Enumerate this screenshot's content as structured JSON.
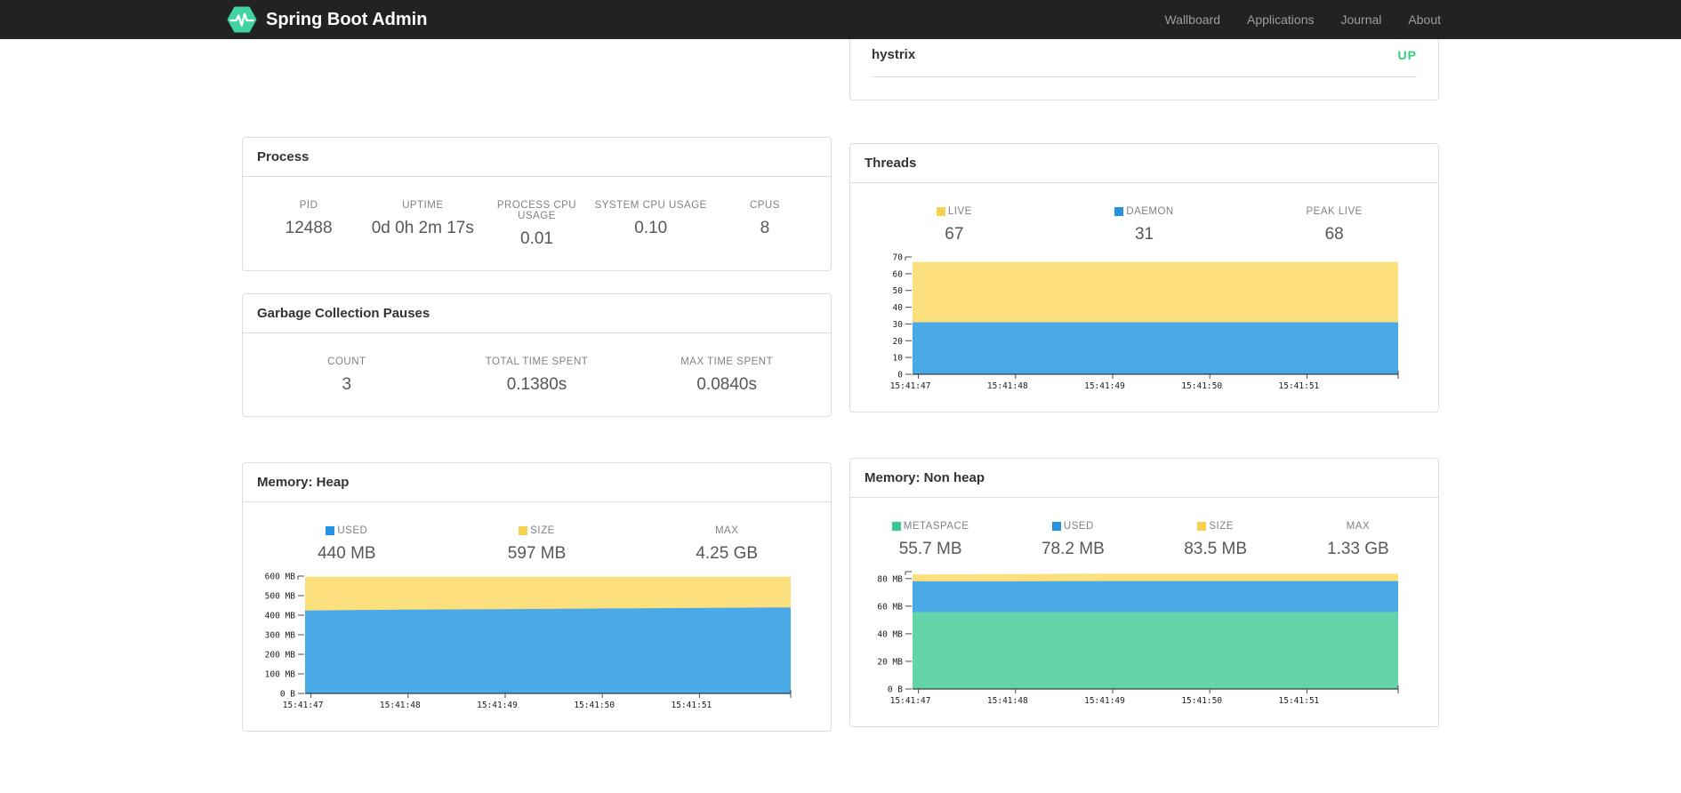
{
  "navbar": {
    "brand": "Spring Boot Admin",
    "links": [
      {
        "id": "wallboard",
        "label": "Wallboard"
      },
      {
        "id": "applications",
        "label": "Applications"
      },
      {
        "id": "journal",
        "label": "Journal"
      },
      {
        "id": "about",
        "label": "About"
      }
    ]
  },
  "colors": {
    "navbar_bg": "#222222",
    "logo_green": "#42d3a3",
    "status_up": "#32d077",
    "legend_yellow": "#f4d250",
    "legend_blue": "#2492e0",
    "legend_green": "#3ec993",
    "area_yellow": "#fce07d",
    "area_blue": "#4aaae8",
    "area_green": "#64d5a8"
  },
  "application_row": {
    "name": "hystrix",
    "status": "UP"
  },
  "panels": {
    "process": {
      "title": "Process",
      "stats": [
        {
          "label": "PID",
          "value": "12488"
        },
        {
          "label": "UPTIME",
          "value": "0d 0h 2m 17s"
        },
        {
          "label": "PROCESS CPU USAGE",
          "value": "0.01"
        },
        {
          "label": "SYSTEM CPU USAGE",
          "value": "0.10"
        },
        {
          "label": "CPUS",
          "value": "8"
        }
      ]
    },
    "gc": {
      "title": "Garbage Collection Pauses",
      "stats": [
        {
          "label": "COUNT",
          "value": "3"
        },
        {
          "label": "TOTAL TIME SPENT",
          "value": "0.1380s"
        },
        {
          "label": "MAX TIME SPENT",
          "value": "0.0840s"
        }
      ]
    },
    "threads": {
      "title": "Threads",
      "stats": [
        {
          "label": "LIVE",
          "value": "67",
          "swatch": "#f4d250"
        },
        {
          "label": "DAEMON",
          "value": "31",
          "swatch": "#2492e0"
        },
        {
          "label": "PEAK LIVE",
          "value": "68"
        }
      ]
    },
    "heap": {
      "title": "Memory: Heap",
      "stats": [
        {
          "label": "USED",
          "value": "440 MB",
          "swatch": "#2492e0"
        },
        {
          "label": "SIZE",
          "value": "597 MB",
          "swatch": "#f4d250"
        },
        {
          "label": "MAX",
          "value": "4.25 GB"
        }
      ]
    },
    "nonheap": {
      "title": "Memory: Non heap",
      "stats": [
        {
          "label": "METASPACE",
          "value": "55.7 MB",
          "swatch": "#3ec993"
        },
        {
          "label": "USED",
          "value": "78.2 MB",
          "swatch": "#2492e0"
        },
        {
          "label": "SIZE",
          "value": "83.5 MB",
          "swatch": "#f4d250"
        },
        {
          "label": "MAX",
          "value": "1.33 GB"
        }
      ]
    }
  },
  "chart_data": [
    {
      "id": "threads",
      "type": "area",
      "title": "Threads",
      "x_ticks": [
        "15:41:47",
        "15:41:48",
        "15:41:49",
        "15:41:50",
        "15:41:51"
      ],
      "ylim": [
        0,
        70
      ],
      "y_ticks": [
        {
          "v": 0,
          "label": "0"
        },
        {
          "v": 10,
          "label": "10"
        },
        {
          "v": 20,
          "label": "20"
        },
        {
          "v": 30,
          "label": "30"
        },
        {
          "v": 40,
          "label": "40"
        },
        {
          "v": 50,
          "label": "50"
        },
        {
          "v": 60,
          "label": "60"
        },
        {
          "v": 70,
          "label": "70"
        }
      ],
      "series": [
        {
          "name": "LIVE",
          "color": "#fce07d",
          "values": [
            67,
            67,
            67,
            67,
            67,
            67
          ]
        },
        {
          "name": "DAEMON",
          "color": "#4aaae8",
          "values": [
            31,
            31,
            31,
            31,
            31,
            31
          ]
        }
      ]
    },
    {
      "id": "heap",
      "type": "area",
      "title": "Memory: Heap",
      "x_ticks": [
        "15:41:47",
        "15:41:48",
        "15:41:49",
        "15:41:50",
        "15:41:51"
      ],
      "ylim": [
        0,
        600
      ],
      "y_ticks": [
        {
          "v": 0,
          "label": "0 B"
        },
        {
          "v": 100,
          "label": "100 MB"
        },
        {
          "v": 200,
          "label": "200 MB"
        },
        {
          "v": 300,
          "label": "300 MB"
        },
        {
          "v": 400,
          "label": "400 MB"
        },
        {
          "v": 500,
          "label": "500 MB"
        },
        {
          "v": 600,
          "label": "600 MB"
        }
      ],
      "series": [
        {
          "name": "SIZE",
          "color": "#fce07d",
          "values": [
            597,
            597,
            597,
            597,
            597,
            597
          ]
        },
        {
          "name": "USED",
          "color": "#4aaae8",
          "values": [
            424,
            428,
            431,
            434,
            437,
            440
          ]
        }
      ]
    },
    {
      "id": "nonheap",
      "type": "area",
      "title": "Memory: Non heap",
      "x_ticks": [
        "15:41:47",
        "15:41:48",
        "15:41:49",
        "15:41:50",
        "15:41:51"
      ],
      "ylim": [
        0,
        85
      ],
      "y_ticks": [
        {
          "v": 0,
          "label": "0 B"
        },
        {
          "v": 20,
          "label": "20 MB"
        },
        {
          "v": 40,
          "label": "40 MB"
        },
        {
          "v": 60,
          "label": "60 MB"
        },
        {
          "v": 80,
          "label": "80 MB"
        }
      ],
      "series": [
        {
          "name": "SIZE",
          "color": "#fce07d",
          "values": [
            83,
            83.2,
            83.5,
            83.5,
            83.5,
            83.5
          ]
        },
        {
          "name": "USED",
          "color": "#4aaae8",
          "values": [
            78,
            78,
            78.2,
            78.2,
            78.2,
            78.2
          ]
        },
        {
          "name": "METASPACE",
          "color": "#64d5a8",
          "values": [
            55.7,
            55.7,
            55.7,
            55.7,
            55.7,
            55.7
          ]
        }
      ]
    }
  ]
}
